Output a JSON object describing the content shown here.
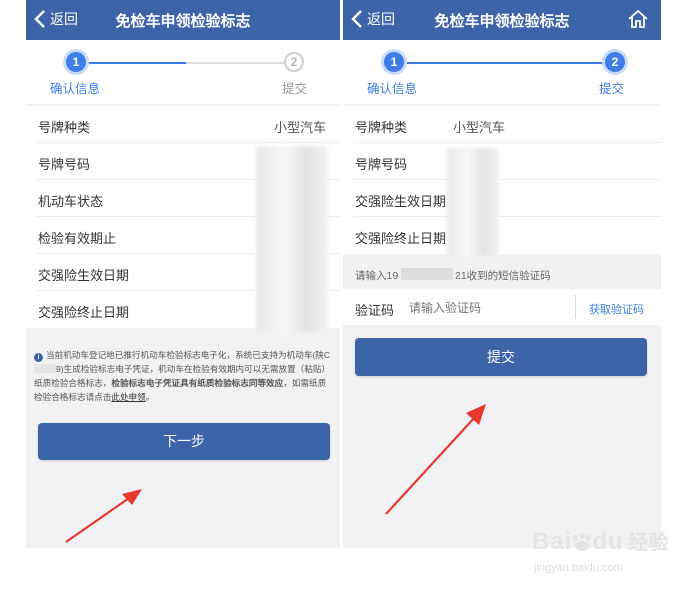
{
  "left_screen": {
    "nav": {
      "back_label": "返回",
      "title": "免检车申领检验标志"
    },
    "steps": [
      {
        "number": "1",
        "label": "确认信息"
      },
      {
        "number": "2",
        "label": "提交"
      }
    ],
    "fields": [
      {
        "label": "号牌种类",
        "value": "小型汽车"
      },
      {
        "label": "号牌号码",
        "value": ""
      },
      {
        "label": "机动车状态",
        "value": ""
      },
      {
        "label": "检验有效期止",
        "value": ""
      },
      {
        "label": "交强险生效日期",
        "value": ""
      },
      {
        "label": "交强险终止日期",
        "value": ""
      }
    ],
    "notice": {
      "part1": "当前机动车登记地已推行机动车检验标志电子化，系统已支持为机动车(陕C",
      "part2": "9)生成检验标志电子凭证，机动车在检验有效期内可以无需放置（粘贴）纸质检验合格标志，",
      "bold": "检验标志电子凭证具有纸质检验标志同等效应",
      "part3": "，如需纸质检验合格标志请点击",
      "link": "此处申领",
      "end": "。"
    },
    "next_button": "下一步"
  },
  "right_screen": {
    "nav": {
      "back_label": "返回",
      "title": "免检车申领检验标志"
    },
    "steps": [
      {
        "number": "1",
        "label": "确认信息"
      },
      {
        "number": "2",
        "label": "提交"
      }
    ],
    "fields": [
      {
        "label": "号牌种类",
        "value": "小型汽车"
      },
      {
        "label": "号牌号码",
        "value": ""
      },
      {
        "label": "交强险生效日期",
        "value": ""
      },
      {
        "label": "交强险终止日期",
        "value": ""
      }
    ],
    "sms_hint": {
      "prefix": "请输入19",
      "suffix": "21收到的短信验证码"
    },
    "code_label": "验证码",
    "code_placeholder": "请输入验证码",
    "get_code_button": "获取验证码",
    "submit_button": "提交"
  },
  "watermark": {
    "brand": "Bai",
    "brand2": "du",
    "suffix": "经验",
    "url": "jingyan.baidu.com"
  },
  "colors": {
    "nav": "#3d63a8",
    "accent": "#3f7de8",
    "arrow": "#e8392f"
  }
}
